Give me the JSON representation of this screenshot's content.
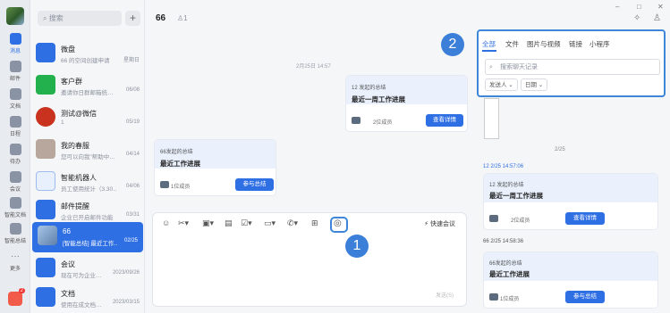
{
  "nav": {
    "items": [
      {
        "label": "消息"
      },
      {
        "label": "邮件"
      },
      {
        "label": "文档"
      },
      {
        "label": "日程"
      },
      {
        "label": "待办"
      },
      {
        "label": "会议"
      },
      {
        "label": "智能文档"
      },
      {
        "label": "智能总结"
      },
      {
        "label": "更多"
      }
    ],
    "badge": "2"
  },
  "list": {
    "search_placeholder": "搜索",
    "plus": "+",
    "conversations": [
      {
        "name": "微盘",
        "preview": "66 的空间创建申请",
        "time": "星期日"
      },
      {
        "name": "客户群",
        "preview": "邀请你日群邮箱统…",
        "time": "06/08"
      },
      {
        "name": "测试@微信",
        "preview": "1",
        "time": "05/19"
      },
      {
        "name": "我的春服",
        "preview": "您可以向我\"帮助中…",
        "time": "04/14"
      },
      {
        "name": "智能机器人",
        "preview": "员工使用统计（3.30…",
        "time": "04/06"
      },
      {
        "name": "邮件提醒",
        "preview": "企业已开启邮件功能",
        "time": "03/31"
      },
      {
        "name": "66",
        "preview": "[智能总结] 最近工作…",
        "time": "02/25"
      },
      {
        "name": "会议",
        "preview": "现在可为企业…",
        "time": "2023/09/26"
      },
      {
        "name": "文档",
        "preview": "使用在成文档…",
        "time": "2023/03/15"
      }
    ]
  },
  "chat": {
    "title": "66",
    "members": "1",
    "divider_time": "2月25日 14:57",
    "card1": {
      "source": "12 发起的总结",
      "title": "最近一周工作进展",
      "members": "2位成员",
      "button": "查看详情"
    },
    "card2": {
      "source": "66发起的总结",
      "title": "最近工作进展",
      "members": "1位成员",
      "button": "参与总结"
    },
    "quick_meeting": "快速会议",
    "send_hint": "发送(S)",
    "badge1": "1"
  },
  "side": {
    "badge2": "2",
    "tabs": [
      "全部",
      "文件",
      "图片与视频",
      "链接",
      "小程序"
    ],
    "search_placeholder": "搜索聊天记录",
    "filters": [
      "发送人",
      "日期"
    ],
    "date_divider": "2/25",
    "msg1_header": "12  2/25 14:57:06",
    "msg1": {
      "source": "12 发起的总结",
      "title": "最近一周工作进展",
      "members": "2位成员",
      "button": "查看详情"
    },
    "msg2_header": "66  2/25 14:58:36",
    "msg2": {
      "source": "66发起的总结",
      "title": "最近工作进展",
      "members": "1位成员",
      "button": "参与总结"
    }
  },
  "colors": {
    "accent": "#2f6fe4",
    "highlight": "#3d86d8"
  }
}
